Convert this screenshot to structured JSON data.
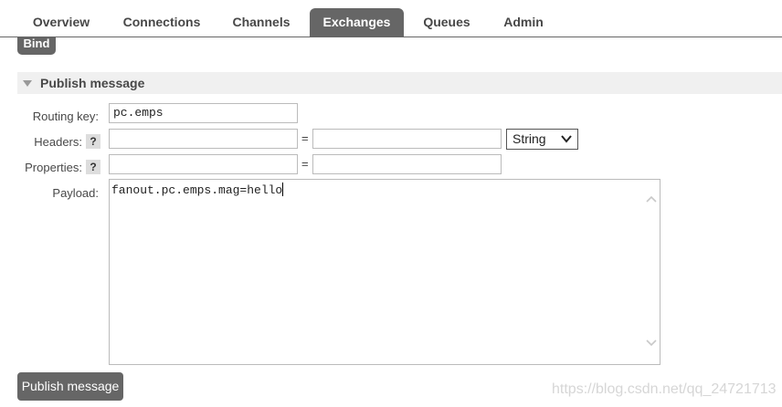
{
  "nav": {
    "tabs": [
      {
        "label": "Overview",
        "active": false
      },
      {
        "label": "Connections",
        "active": false
      },
      {
        "label": "Channels",
        "active": false
      },
      {
        "label": "Exchanges",
        "active": true
      },
      {
        "label": "Queues",
        "active": false
      },
      {
        "label": "Admin",
        "active": false
      }
    ]
  },
  "bind_button": {
    "label": "Bind"
  },
  "publish_section": {
    "title": "Publish message",
    "routing_key": {
      "label": "Routing key:",
      "value": "pc.emps"
    },
    "headers": {
      "label": "Headers:",
      "help": "?",
      "key_value": "",
      "equals": "=",
      "value_value": "",
      "type_selected": "String"
    },
    "properties": {
      "label": "Properties:",
      "help": "?",
      "key_value": "",
      "equals": "=",
      "value_value": ""
    },
    "payload": {
      "label": "Payload:",
      "value": "fanout.pc.emps.mag=hello"
    },
    "publish_button": {
      "label": "Publish message"
    }
  },
  "watermark": "https://blog.csdn.net/qq_24721713",
  "colors": {
    "tab_active_bg": "#666666",
    "button_bg": "#666666",
    "section_bg": "#f0f0f0",
    "text": "#484848"
  }
}
